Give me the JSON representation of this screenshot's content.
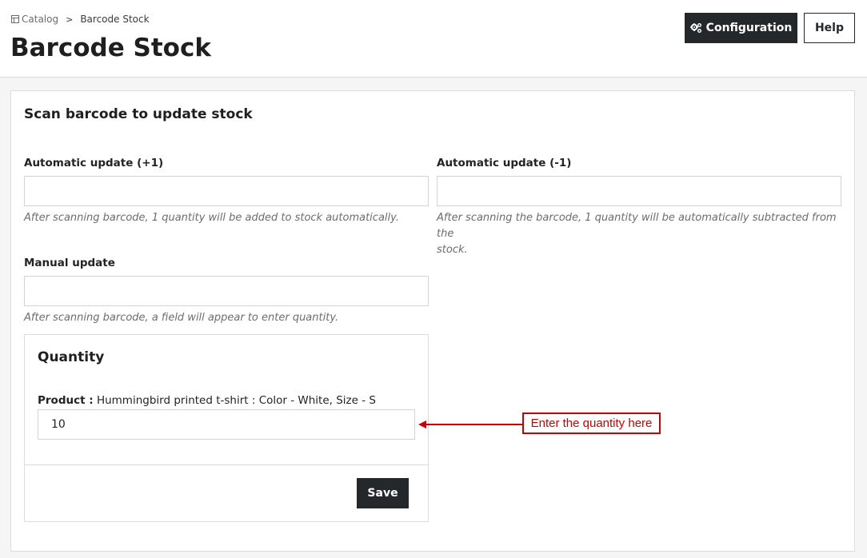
{
  "breadcrumb": {
    "parent": "Catalog",
    "separator": ">",
    "current": "Barcode Stock"
  },
  "header": {
    "title": "Barcode Stock",
    "config_label": "Configuration",
    "help_label": "Help"
  },
  "card": {
    "title": "Scan barcode to update stock",
    "auto_plus": {
      "label": "Automatic update (+1)",
      "value": "",
      "help": "After scanning barcode, 1 quantity will be added to stock automatically."
    },
    "auto_minus": {
      "label": "Automatic update (-1)",
      "value": "",
      "help_line1": "After scanning the barcode, 1 quantity will be automatically subtracted from the",
      "help_line2": "stock."
    },
    "manual": {
      "label": "Manual update",
      "value": "",
      "help": "After scanning barcode, a field will appear to enter quantity."
    }
  },
  "quantity": {
    "title": "Quantity",
    "product_label": "Product :",
    "product_name": "Hummingbird printed t-shirt : Color - White, Size - S",
    "value": "10",
    "save_label": "Save"
  },
  "annotation": {
    "text": "Enter the quantity here",
    "color": "#c80000"
  },
  "colors": {
    "dark_button": "#25282b",
    "page_bg": "#f5f5f5"
  }
}
